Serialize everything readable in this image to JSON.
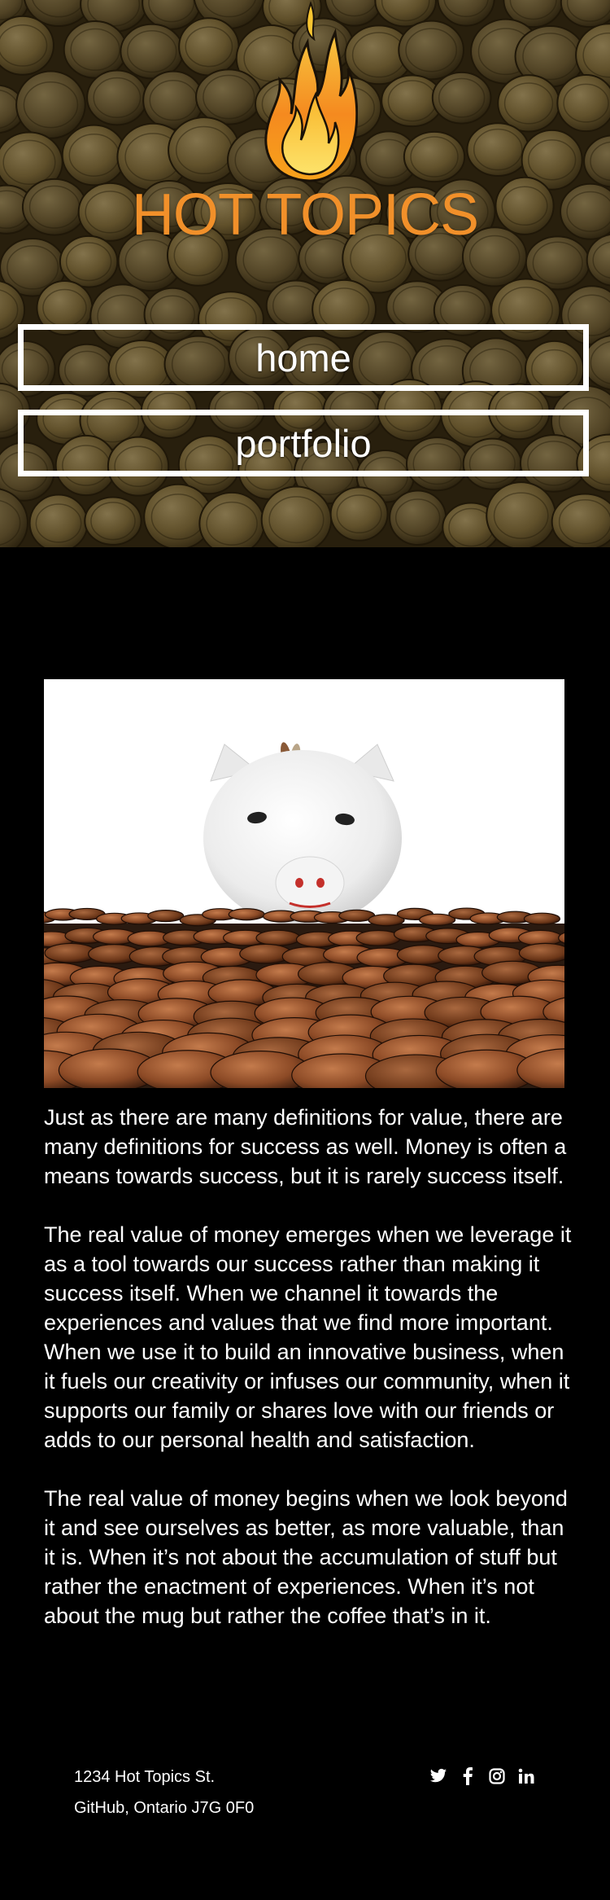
{
  "brand": {
    "title": "HOT TOPICS",
    "title_color": "#f1902a",
    "logo_icon": "flame-icon"
  },
  "nav": {
    "items": [
      {
        "label": "home"
      },
      {
        "label": "portfolio"
      }
    ]
  },
  "hero": {
    "image": "piggy-bank-on-coins"
  },
  "article": {
    "paragraphs": [
      "Just as there are many definitions for value, there are many definitions for success as well. Money is often a means towards success, but it is rarely success itself.",
      "The real value of money emerges when we leverage it as a tool towards our success rather than making it success itself. When we channel it towards the experiences and values that we find more important. When we use it to build an innovative business, when it fuels our creativity or infuses our community, when it supports our family or shares love with our friends or adds to our personal health and satisfaction.",
      "The real value of money begins when we look beyond it and see ourselves as better, as more valuable, than it is. When it’s not about the accumulation of stuff but rather the enactment of experiences. When it’s not about the mug but rather the coffee that’s in it."
    ]
  },
  "footer": {
    "address_line1": "1234 Hot Topics St.",
    "address_line2": "GitHub, Ontario J7G 0F0",
    "social": [
      "twitter-icon",
      "facebook-icon",
      "instagram-icon",
      "linkedin-icon"
    ]
  }
}
